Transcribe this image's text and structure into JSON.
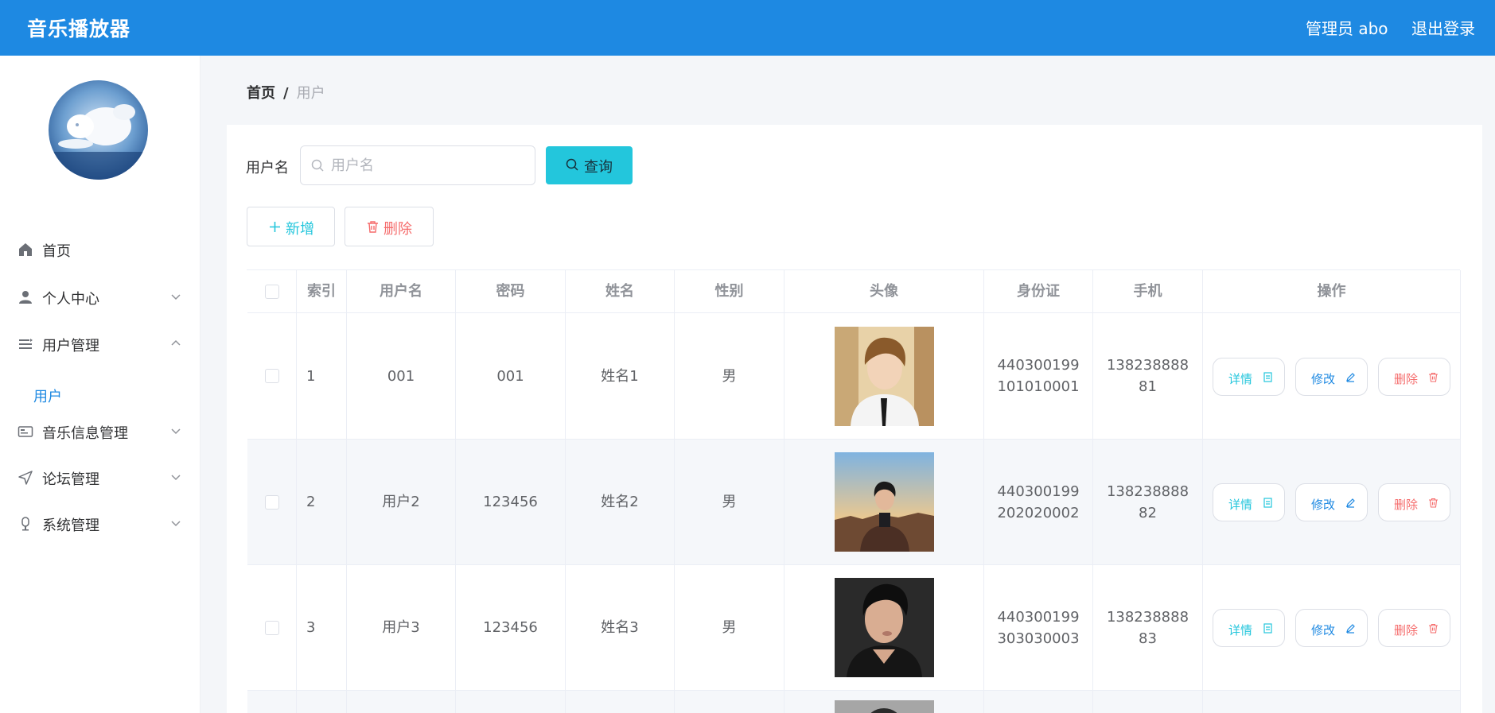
{
  "header": {
    "title": "音乐播放器",
    "admin_label": "管理员 abo",
    "logout_label": "退出登录"
  },
  "sidebar": {
    "items": [
      {
        "label": "首页",
        "icon": "home-icon"
      },
      {
        "label": "个人中心",
        "icon": "user-icon"
      },
      {
        "label": "用户管理",
        "icon": "list-icon"
      },
      {
        "label": "用户",
        "sub": true
      },
      {
        "label": "音乐信息管理",
        "icon": "id-card-icon"
      },
      {
        "label": "论坛管理",
        "icon": "send-icon"
      },
      {
        "label": "系统管理",
        "icon": "microphone-icon"
      }
    ]
  },
  "breadcrumb": {
    "home": "首页",
    "separator": "/",
    "current": "用户"
  },
  "search": {
    "label": "用户名",
    "placeholder": "用户名",
    "value": "",
    "query_label": "查询"
  },
  "actions": {
    "add_label": "新增",
    "delete_label": "删除"
  },
  "table": {
    "columns": [
      "索引",
      "用户名",
      "密码",
      "姓名",
      "性别",
      "头像",
      "身份证",
      "手机",
      "操作"
    ],
    "rows": [
      {
        "index": "1",
        "username": "001",
        "password": "001",
        "name": "姓名1",
        "gender": "男",
        "id_card": "440300199101010001",
        "phone": "13823888881"
      },
      {
        "index": "2",
        "username": "用户2",
        "password": "123456",
        "name": "姓名2",
        "gender": "男",
        "id_card": "440300199202020002",
        "phone": "13823888882"
      },
      {
        "index": "3",
        "username": "用户3",
        "password": "123456",
        "name": "姓名3",
        "gender": "男",
        "id_card": "440300199303030003",
        "phone": "13823888883"
      }
    ],
    "op_labels": {
      "detail": "详情",
      "edit": "修改",
      "delete": "删除"
    }
  },
  "colors": {
    "primary": "#1e89e2",
    "accent": "#23c6dc",
    "danger": "#f56c6c"
  }
}
